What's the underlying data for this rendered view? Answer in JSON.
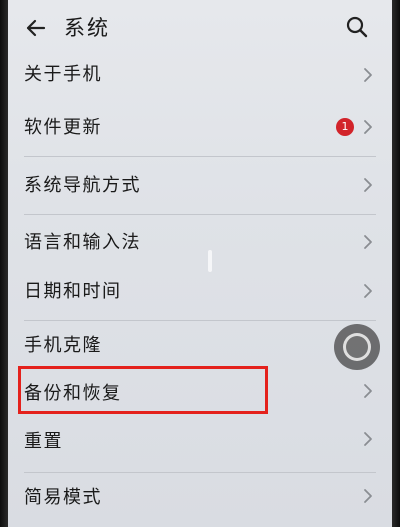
{
  "header": {
    "title": "系统",
    "back_icon": "back-arrow-icon",
    "search_icon": "search-icon"
  },
  "settings": {
    "items": [
      {
        "label": "关于手机"
      },
      {
        "label": "软件更新",
        "badge": "1"
      },
      {
        "label": "系统导航方式"
      },
      {
        "label": "语言和输入法"
      },
      {
        "label": "日期和时间"
      },
      {
        "label": "手机克隆"
      },
      {
        "label": "备份和恢复"
      },
      {
        "label": "重置"
      },
      {
        "label": "简易模式"
      }
    ]
  },
  "colors": {
    "screen_background": "#e0e3e8",
    "badge": "#d2232a",
    "highlight_box": "#e4211c",
    "divider": "#c3c6cc",
    "text": "#1a1a1a"
  }
}
